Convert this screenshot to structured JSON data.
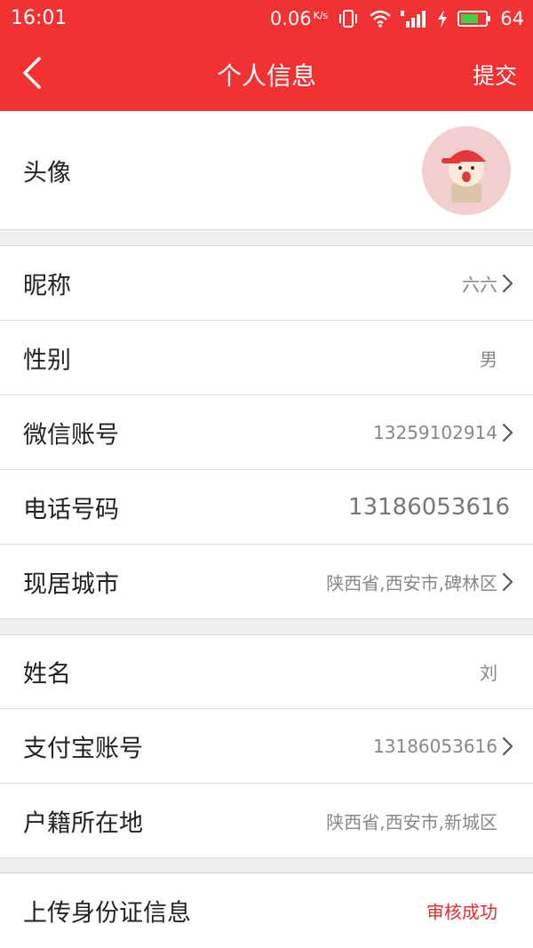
{
  "status_bar": {
    "time": "16:01",
    "net_speed": "0.06",
    "net_unit": "K/s",
    "battery": "64"
  },
  "header": {
    "title": "个人信息",
    "submit_label": "提交",
    "back_icon": "chevron-left-icon",
    "bg_color": "#f23232"
  },
  "profile": {
    "avatar_label": "头像"
  },
  "section1": [
    {
      "label": "昵称",
      "value": "六六"
    },
    {
      "label": "性别",
      "value": "男"
    },
    {
      "label": "微信账号",
      "value": "13259102914"
    },
    {
      "label": "电话号码",
      "value": "13186053616"
    },
    {
      "label": "现居城市",
      "value": "陕西省,西安市,碑林区"
    }
  ],
  "section2": [
    {
      "label": "姓名",
      "value": "刘"
    },
    {
      "label": "支付宝账号",
      "value": "13186053616"
    },
    {
      "label": "户籍所在地",
      "value": "陕西省,西安市,新城区"
    }
  ],
  "section3": [
    {
      "label": "上传身份证信息",
      "value": "审核成功",
      "value_color": "#e0302f"
    }
  ]
}
